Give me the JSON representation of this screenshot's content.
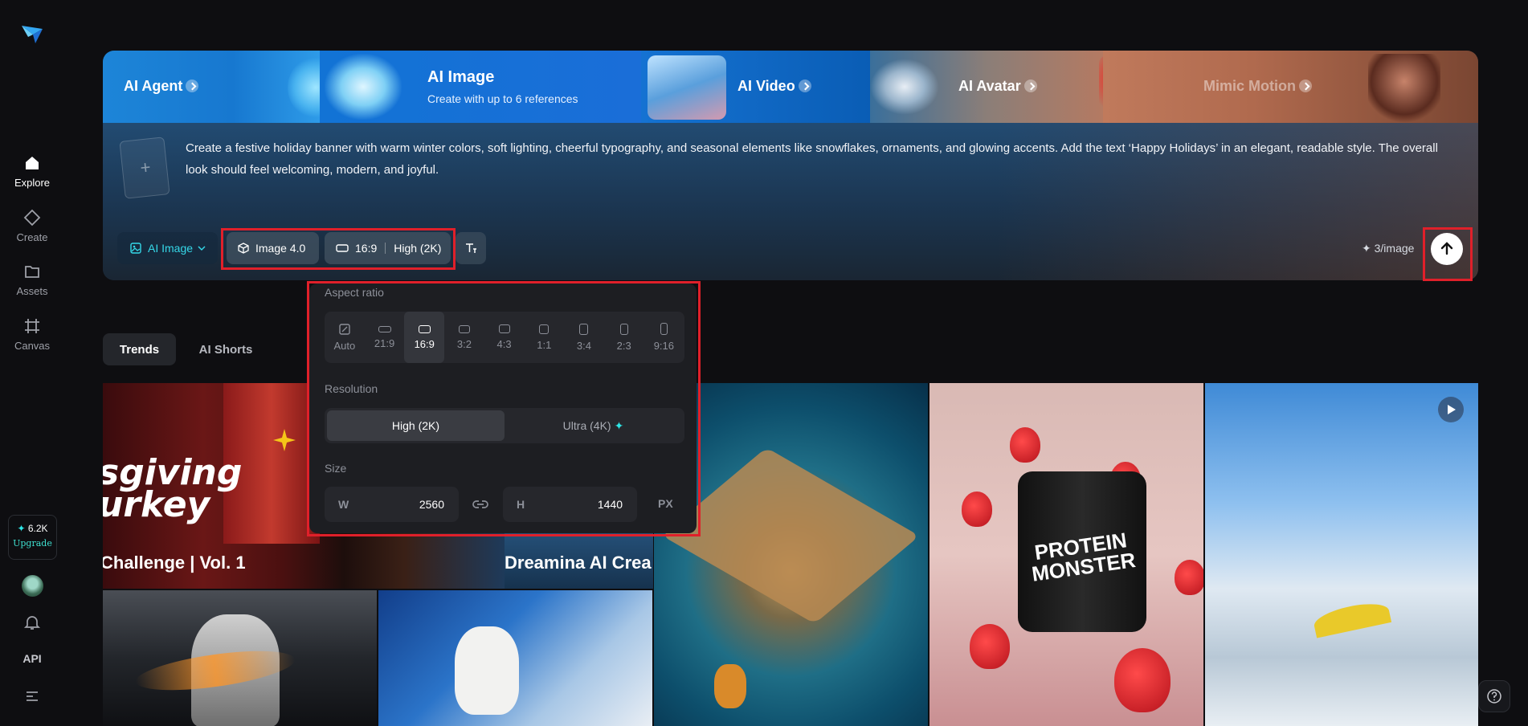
{
  "sidebar": {
    "items": [
      {
        "label": "Explore"
      },
      {
        "label": "Create"
      },
      {
        "label": "Assets"
      },
      {
        "label": "Canvas"
      }
    ],
    "credits": {
      "amount": "6.2K",
      "upgrade_label": "Upgrade"
    },
    "api_label": "API"
  },
  "hero": {
    "tabs": {
      "agent": "AI Agent",
      "image_title": "AI Image",
      "image_subtitle": "Create with up to 6 references",
      "video": "AI Video",
      "avatar": "AI Avatar",
      "mimic": "Mimic Motion"
    },
    "prompt": "Create a festive holiday banner with warm winter colors, soft lighting, cheerful typography, and seasonal elements like snowflakes, ornaments, and glowing accents. Add the text ‘Happy Holidays’ in an elegant, readable style. The overall look should feel welcoming, modern, and joyful.",
    "controls": {
      "mode": "AI Image",
      "model": "Image 4.0",
      "ratio": "16:9",
      "resolution": "High (2K)"
    },
    "cost": "3/image"
  },
  "popup": {
    "aspect_title": "Aspect ratio",
    "ratios": [
      "Auto",
      "21:9",
      "16:9",
      "3:2",
      "4:3",
      "1:1",
      "3:4",
      "2:3",
      "9:16"
    ],
    "selected_ratio": "16:9",
    "resolution_title": "Resolution",
    "resolution_options": [
      "High (2K)",
      "Ultra (4K)"
    ],
    "size_title": "Size",
    "width_label": "W",
    "width": "2560",
    "height_label": "H",
    "height": "1440",
    "unit": "PX"
  },
  "feed_tabs": [
    "Trends",
    "AI Shorts"
  ],
  "gallery": {
    "tile1_big_text": "sgiving\nurkey",
    "tile1_caption": "Challenge | Vol. 1",
    "tile2_caption": "Dreamina AI Crea",
    "tile4_label": "PROTEIN MONSTER"
  },
  "colors": {
    "accent": "#2ee6e6",
    "highlight": "#e0202a"
  },
  "icons": [
    "logo-icon",
    "home-icon",
    "create-icon",
    "folder-icon",
    "canvas-icon",
    "bell-icon",
    "menu-icon",
    "image-icon",
    "cube-icon",
    "ratio-icon",
    "text-size-icon",
    "arrow-up-icon",
    "link-icon",
    "play-icon",
    "help-icon"
  ]
}
